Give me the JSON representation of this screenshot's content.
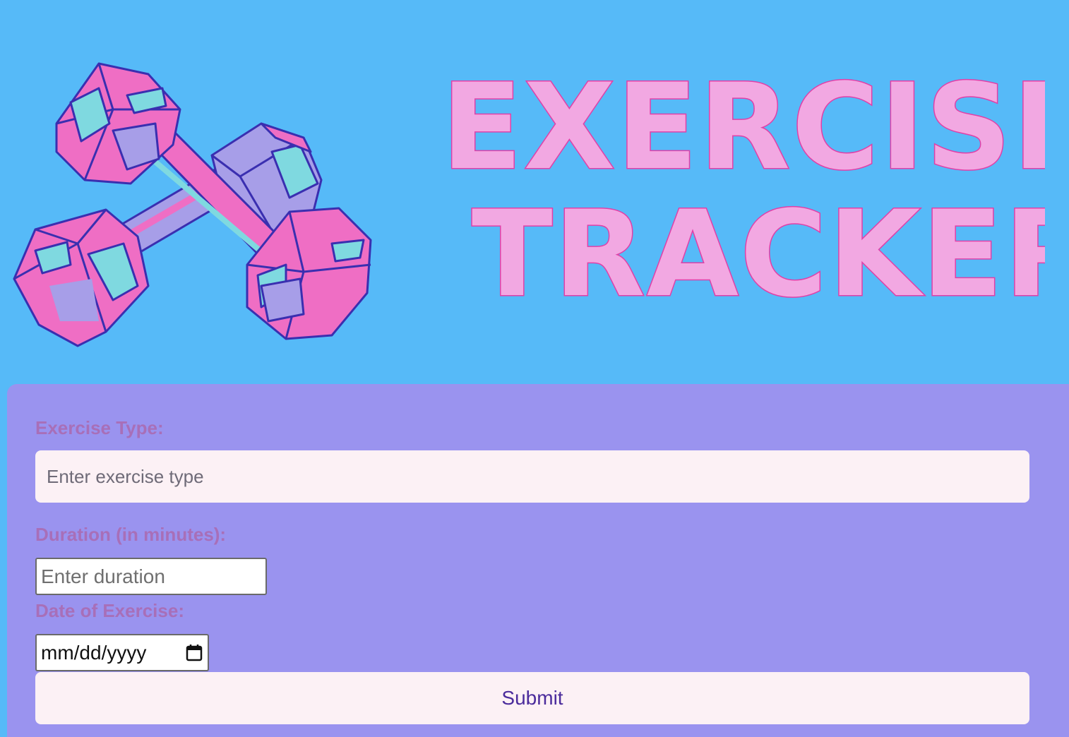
{
  "header": {
    "title_line1": "EXERCISE",
    "title_line2": "TRACKER",
    "logo_icon": "dumbbells-icon"
  },
  "form": {
    "exercise_type_label": "Exercise Type:",
    "exercise_type_placeholder": "Enter exercise type",
    "exercise_type_value": "",
    "duration_label": "Duration (in minutes):",
    "duration_placeholder": "Enter duration",
    "duration_value": "",
    "date_label": "Date of Exercise:",
    "date_placeholder": "mm/dd/yyyy",
    "calendar_icon": "calendar-icon",
    "submit_label": "Submit"
  },
  "colors": {
    "page_background": "#56baf8",
    "form_background": "#9a93ef",
    "label_color": "#a86fb8",
    "input_background": "#fcf1f5",
    "title_fill": "#f2a8e2",
    "title_stroke": "#e040a8",
    "button_text": "#4b2c9c"
  }
}
